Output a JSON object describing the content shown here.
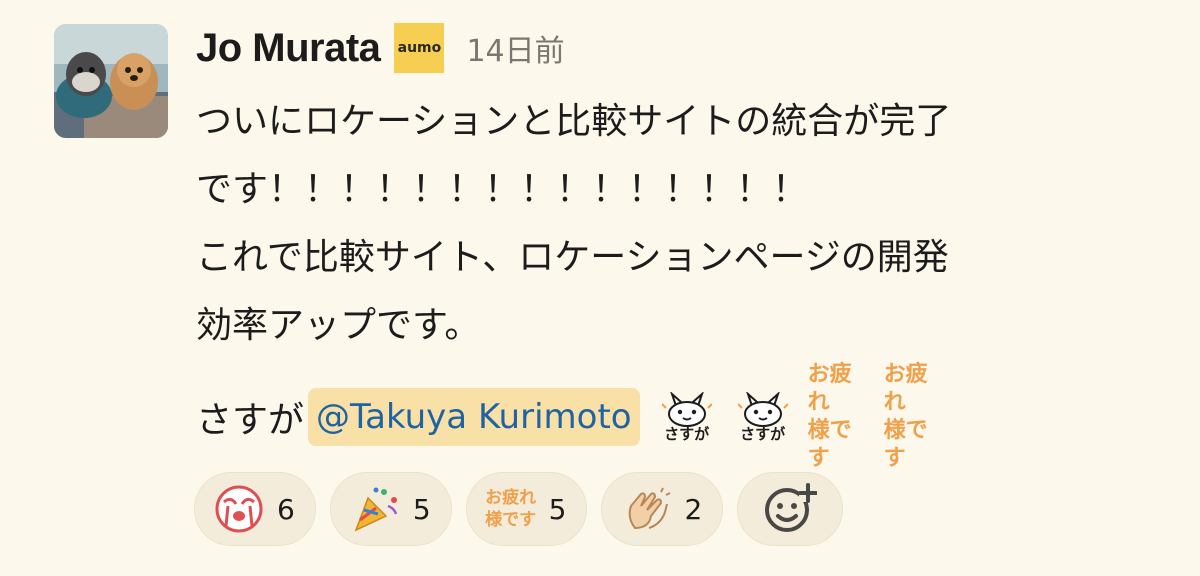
{
  "message": {
    "author": "Jo Murata",
    "org_badge": "aumo",
    "timestamp": "14日前",
    "body_lines": "ついにロケーションと比較サイトの統合が完了\nです！！！！！！！！！！！！！！！\nこれで比較サイト、ロケーションページの開発\n効率アップです。",
    "line2_text": "さすが",
    "mention": "@Takuya Kurimoto",
    "inline_emojis": [
      {
        "name": "sasuga-icon",
        "label": "さすが"
      },
      {
        "name": "sasuga-icon",
        "label": "さすが"
      },
      {
        "name": "otsukaresama-icon",
        "line1": "お疲れ",
        "line2": "様です"
      },
      {
        "name": "otsukaresama-icon",
        "line1": "お疲れ",
        "line2": "様です"
      }
    ]
  },
  "reactions": [
    {
      "icon": "crying-face-icon",
      "count": "6"
    },
    {
      "icon": "party-popper-icon",
      "count": "5"
    },
    {
      "icon": "otsukaresama-icon",
      "line1": "お疲れ",
      "line2": "様です",
      "count": "5"
    },
    {
      "icon": "clapping-hands-icon",
      "count": "2"
    }
  ],
  "add_reaction_icon": "add-reaction-icon",
  "colors": {
    "background": "#fdf8ec",
    "mention_bg": "#f8e0a6",
    "mention_text": "#1f63a3",
    "badge": "#f6cf52",
    "otsukare_orange": "#f0a04a"
  }
}
